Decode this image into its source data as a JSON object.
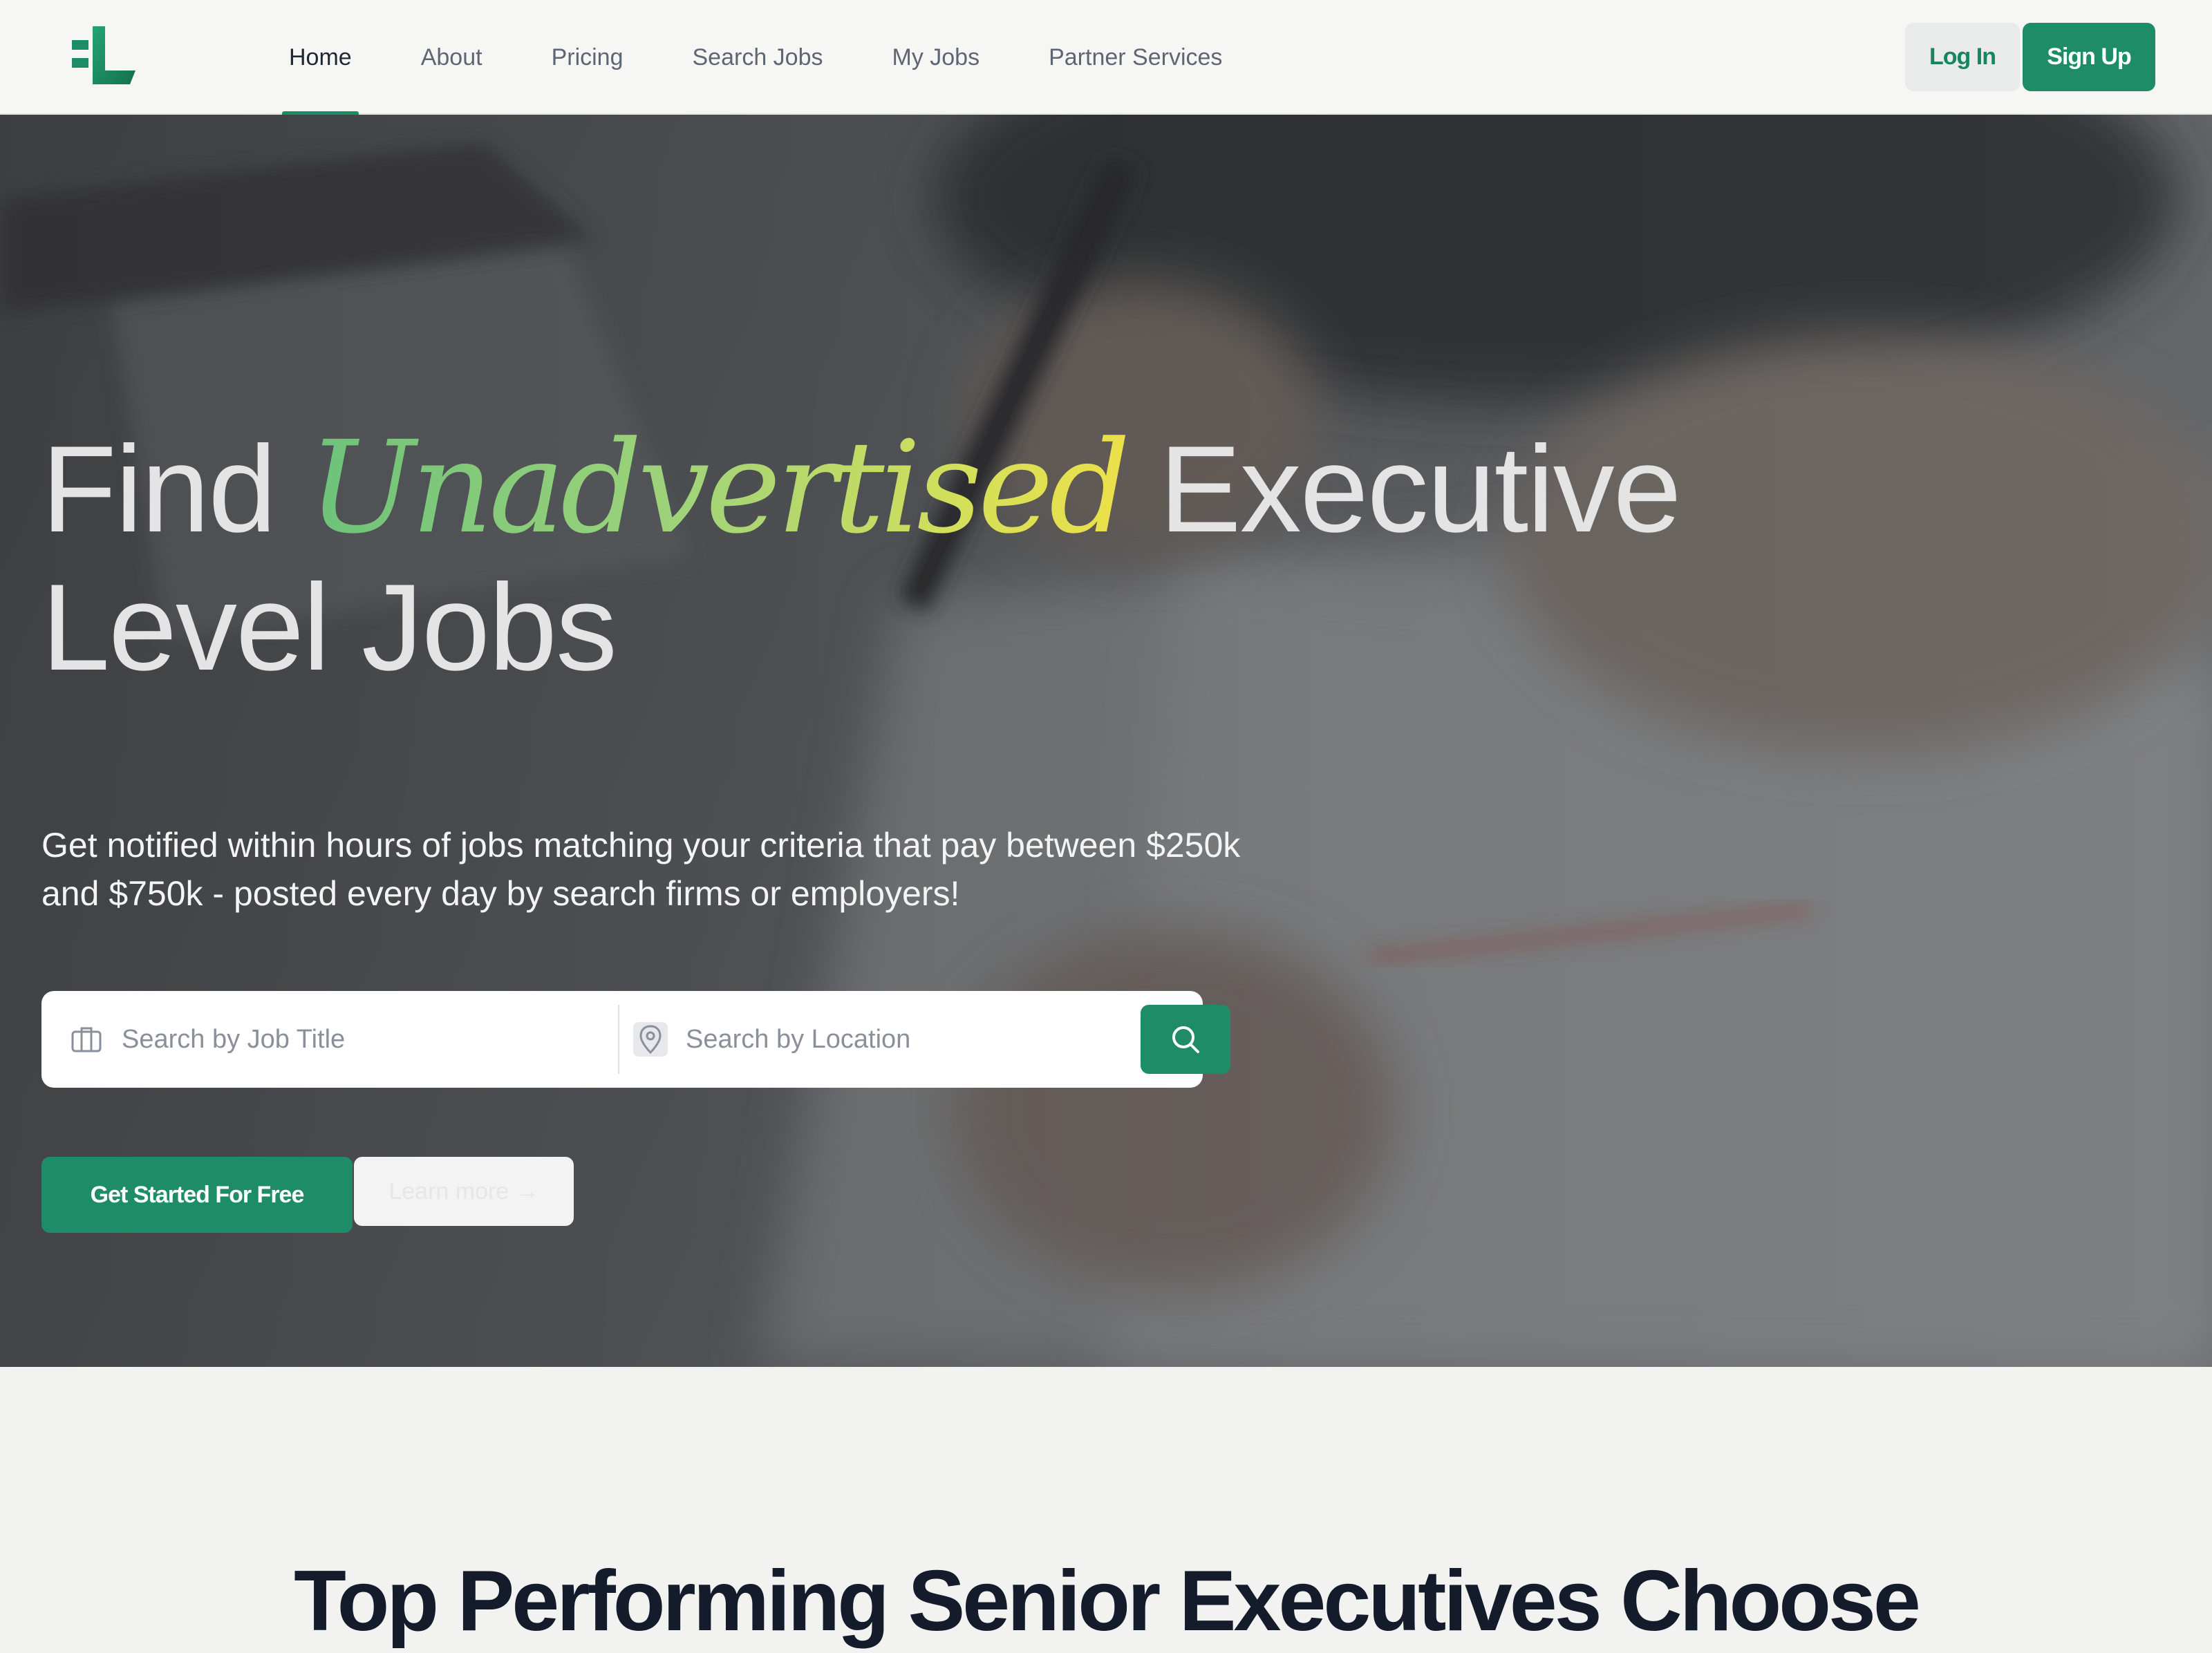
{
  "nav": {
    "links": [
      "Home",
      "About",
      "Pricing",
      "Search Jobs",
      "My Jobs",
      "Partner Services"
    ],
    "active": "Home",
    "login_label": "Log In",
    "signup_label": "Sign Up"
  },
  "hero": {
    "title_before": "Find ",
    "title_accent": "Unadvertised",
    "title_after": " Executive Level Jobs",
    "subtitle": "Get notified within hours of jobs matching your criteria that pay between $250k and $750k - posted every day by search firms or employers!",
    "search": {
      "job_placeholder": "Search by Job Title",
      "location_placeholder": "Search by Location"
    },
    "cta_primary": "Get Started For Free",
    "cta_secondary": "Learn more →"
  },
  "section": {
    "heading": "Top Performing Senior Executives Choose"
  },
  "icons": {
    "job_field": "briefcase-icon",
    "location_field": "map-pin-icon",
    "search_button": "search-icon"
  },
  "colors": {
    "brand": "#1e8c67",
    "accent_gradient": [
      "#6cc27a",
      "#ece04a"
    ],
    "heading": "#141b2b"
  }
}
